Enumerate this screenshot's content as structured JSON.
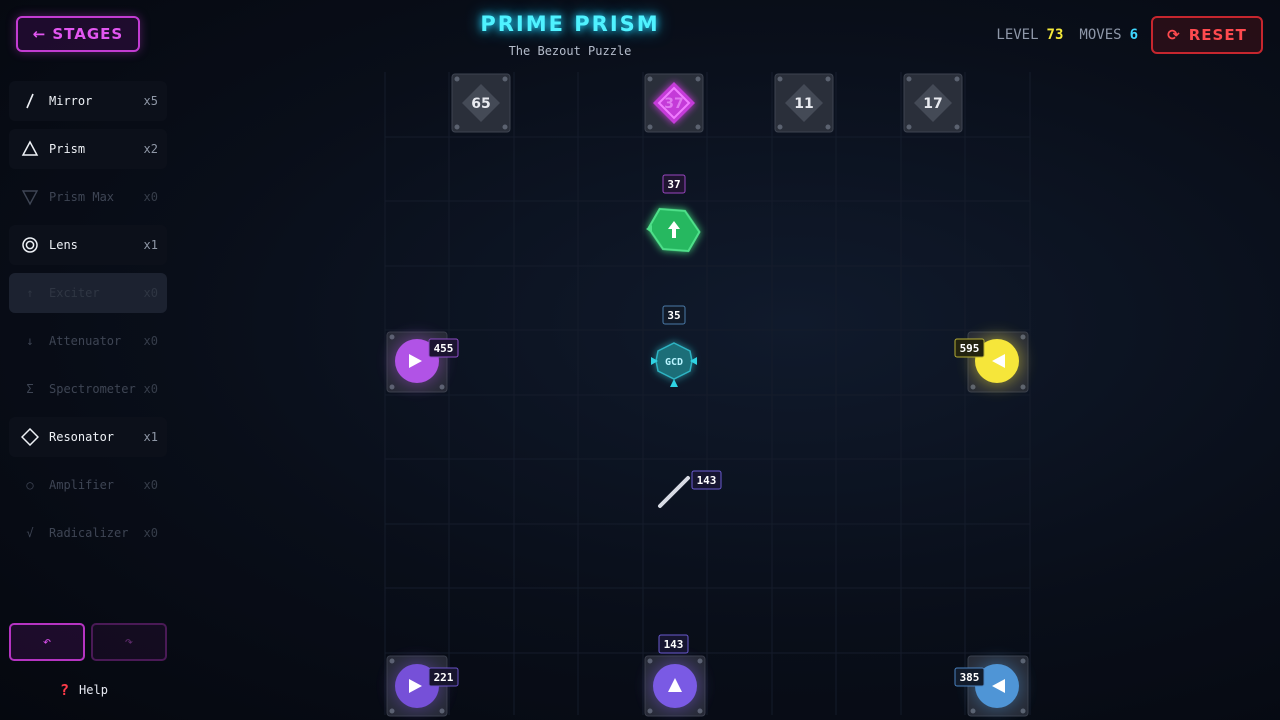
{
  "header": {
    "stages_label": "STAGES",
    "title": "PRIME PRISM",
    "subtitle": "The Bezout Puzzle",
    "level_label": "LEVEL",
    "level_value": "73",
    "moves_label": "MOVES",
    "moves_value": "6",
    "reset_label": "RESET"
  },
  "tools": [
    {
      "name": "Mirror",
      "count": "x5",
      "icon": "mirror-icon",
      "state": "on"
    },
    {
      "name": "Prism",
      "count": "x2",
      "icon": "triangle-icon",
      "state": "on"
    },
    {
      "name": "Prism Max",
      "count": "x0",
      "icon": "triangle-down-icon",
      "state": "off"
    },
    {
      "name": "Lens",
      "count": "x1",
      "icon": "lens-icon",
      "state": "on"
    },
    {
      "name": "Exciter",
      "count": "x0",
      "icon": "arrow-up-icon",
      "state": "selected"
    },
    {
      "name": "Attenuator",
      "count": "x0",
      "icon": "arrow-down-icon",
      "state": "off"
    },
    {
      "name": "Spectrometer",
      "count": "x0",
      "icon": "sigma-icon",
      "state": "off"
    },
    {
      "name": "Resonator",
      "count": "x1",
      "icon": "diamond-icon",
      "state": "on"
    },
    {
      "name": "Amplifier",
      "count": "x0",
      "icon": "circle-icon",
      "state": "off"
    },
    {
      "name": "Radicalizer",
      "count": "x0",
      "icon": "sqrt-icon",
      "state": "off"
    }
  ],
  "controls": {
    "undo_icon": "undo-icon",
    "redo_icon": "redo-icon",
    "help_label": "Help"
  },
  "targets": [
    "65",
    "37",
    "11",
    "17"
  ],
  "sources": [
    {
      "value": "455",
      "color": "#b153e6"
    },
    {
      "value": "595",
      "color": "#f6e63a"
    },
    {
      "value": "221",
      "color": "#7650d8"
    },
    {
      "value": "385",
      "color": "#4f95d6"
    }
  ],
  "gcd_label": "GCD",
  "beam_labels": [
    "37",
    "35",
    "143",
    "143"
  ],
  "colors": {
    "accent": "#4ff2ff",
    "magenta": "#d64ee6",
    "reset": "#ff4a4f",
    "level": "#f5ea3a",
    "green": "#27b860"
  }
}
